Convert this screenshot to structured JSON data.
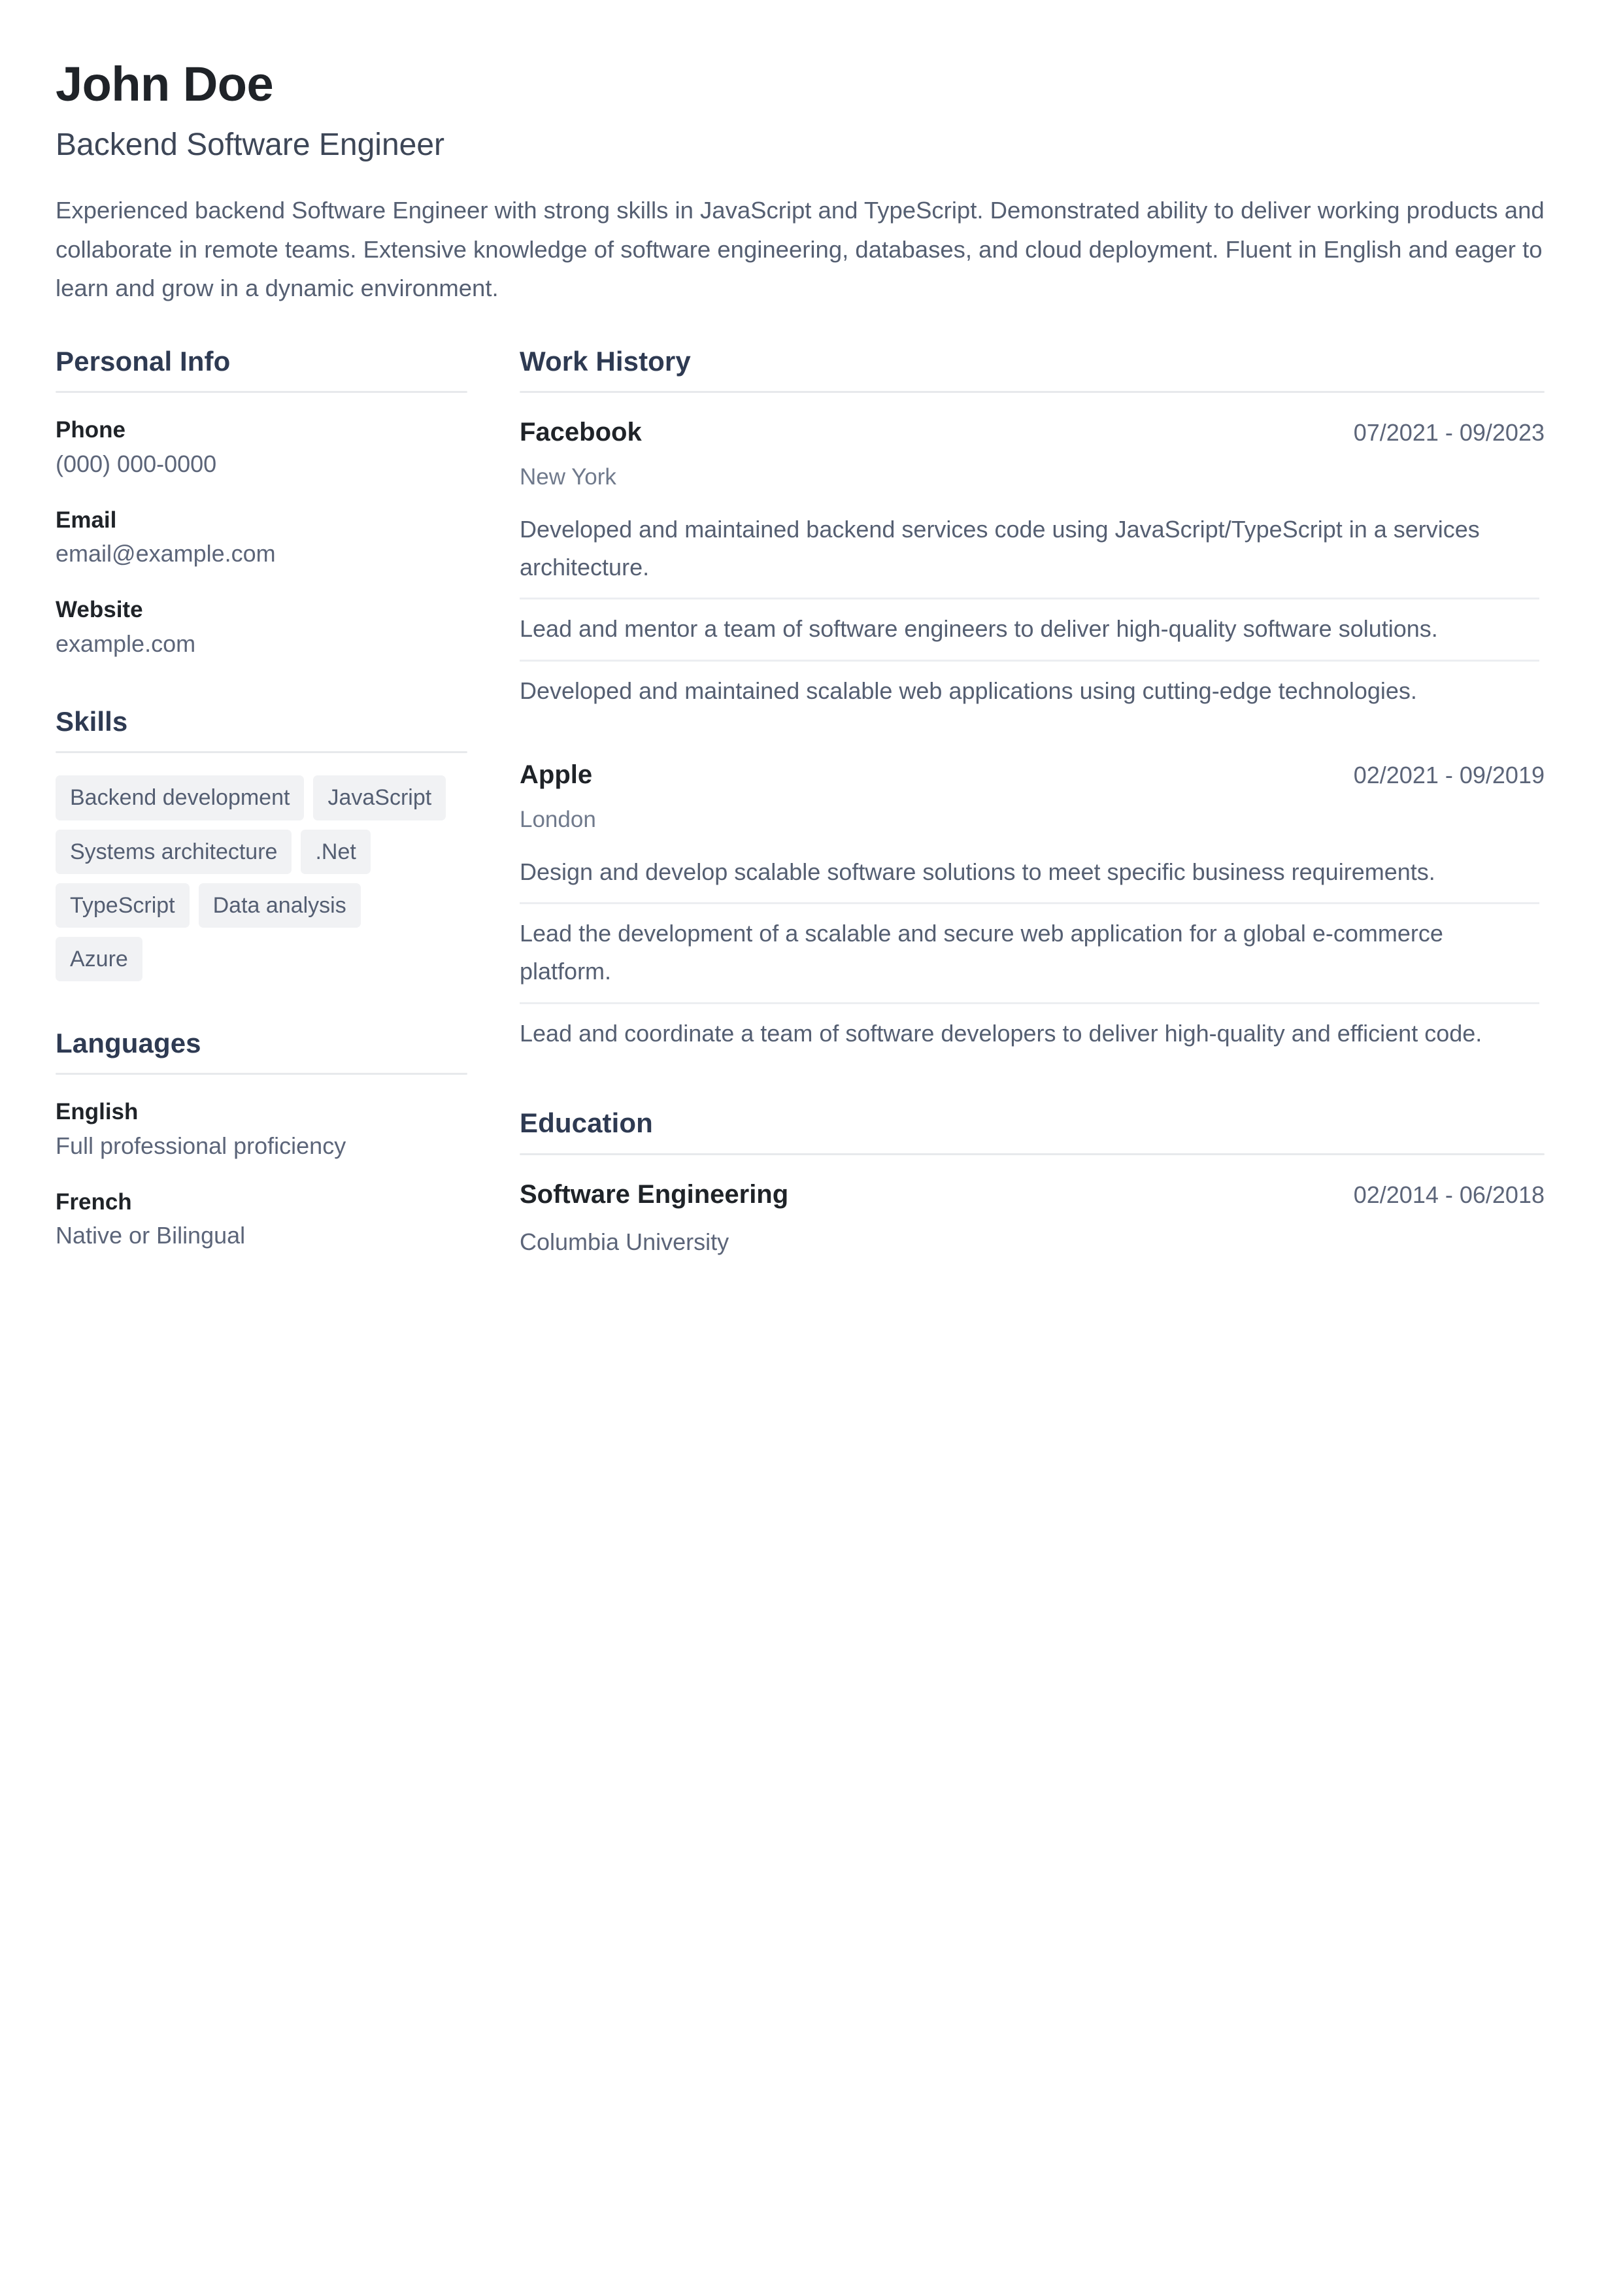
{
  "header": {
    "name": "John Doe",
    "job_title": "Backend Software Engineer",
    "summary": "Experienced backend Software Engineer with strong skills in JavaScript and TypeScript. Demonstrated ability to deliver working products and collaborate in remote teams. Extensive knowledge of software engineering, databases, and cloud deployment. Fluent in English and eager to learn and grow in a dynamic environment."
  },
  "sidebar": {
    "personal_info": {
      "heading": "Personal Info",
      "items": [
        {
          "label": "Phone",
          "value": "(000) 000-0000"
        },
        {
          "label": "Email",
          "value": "email@example.com"
        },
        {
          "label": "Website",
          "value": "example.com"
        }
      ]
    },
    "skills": {
      "heading": "Skills",
      "items": [
        "Backend development",
        "JavaScript",
        "Systems architecture",
        ".Net",
        "TypeScript",
        "Data analysis",
        "Azure"
      ]
    },
    "languages": {
      "heading": "Languages",
      "items": [
        {
          "name": "English",
          "level": "Full professional proficiency"
        },
        {
          "name": "French",
          "level": "Native or Bilingual"
        }
      ]
    }
  },
  "main": {
    "work_history": {
      "heading": "Work History",
      "entries": [
        {
          "org": "Facebook",
          "dates": "07/2021 - 09/2023",
          "location": "New York",
          "bullets": [
            "Developed and maintained backend services code using JavaScript/TypeScript in a services architecture.",
            "Lead and mentor a team of software engineers to deliver high-quality software solutions.",
            "Developed and maintained scalable web applications using cutting-edge technologies."
          ]
        },
        {
          "org": "Apple",
          "dates": "02/2021 - 09/2019",
          "location": "London",
          "bullets": [
            "Design and develop scalable software solutions to meet specific business requirements.",
            "Lead the development of a scalable and secure web application for a global e-commerce platform.",
            "Lead and coordinate a team of software developers to deliver high-quality and efficient code."
          ]
        }
      ]
    },
    "education": {
      "heading": "Education",
      "entries": [
        {
          "degree": "Software Engineering",
          "dates": "02/2014 - 06/2018",
          "school": "Columbia University"
        }
      ]
    }
  },
  "colors": {
    "heading": "#2e3a52",
    "strong_text": "#1f2328",
    "body_text": "#555f72",
    "muted_text": "#5c6579",
    "rule": "#e7e9ec",
    "chip_bg": "#f1f2f4",
    "page_bg": "#ffffff"
  }
}
